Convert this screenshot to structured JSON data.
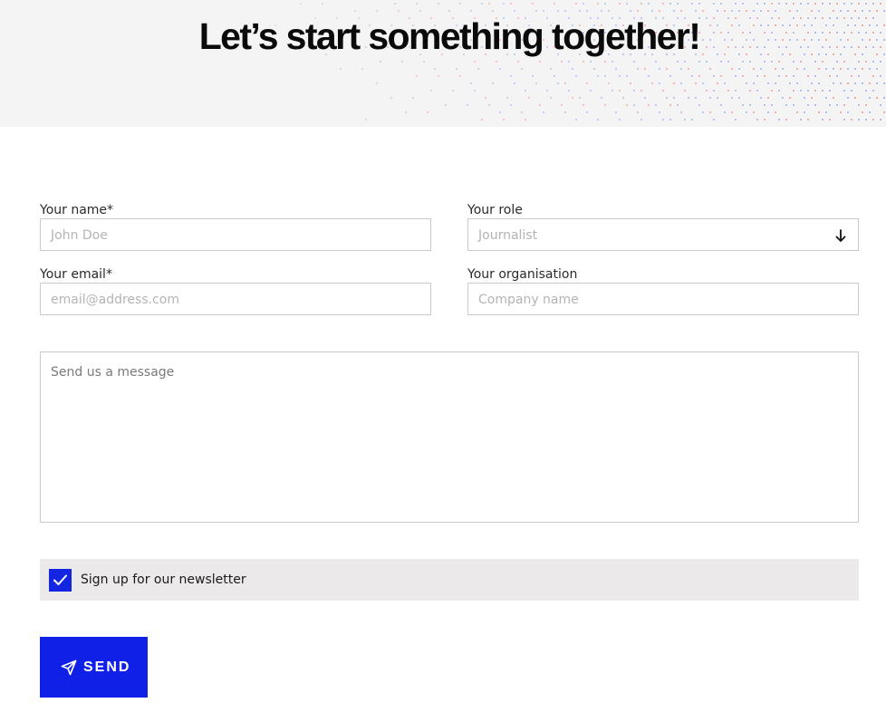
{
  "header": {
    "title": "Let’s start something together!"
  },
  "form": {
    "name": {
      "label": "Your name*",
      "placeholder": "John Doe"
    },
    "role": {
      "label": "Your role",
      "selected": "Journalist"
    },
    "email": {
      "label": "Your email*",
      "placeholder": "email@address.com"
    },
    "organisation": {
      "label": "Your organisation",
      "placeholder": "Company name"
    },
    "message": {
      "placeholder": "Send us a message"
    },
    "newsletter": {
      "label": "Sign up for our newsletter",
      "checked": true
    },
    "submit": {
      "label": "SEND",
      "icon": "send-icon"
    }
  },
  "colors": {
    "accent": "#1020e6",
    "hero_background": "#f4f4f4",
    "newsletter_background": "#ebe9e9",
    "input_border": "#c9c9c9",
    "dot_red": "#ef6a6a",
    "dot_blue": "#6f8cf2"
  },
  "icons": {
    "select_arrow": "arrow-down-icon",
    "checkbox_mark": "checkmark-icon",
    "send": "paper-plane-icon"
  }
}
